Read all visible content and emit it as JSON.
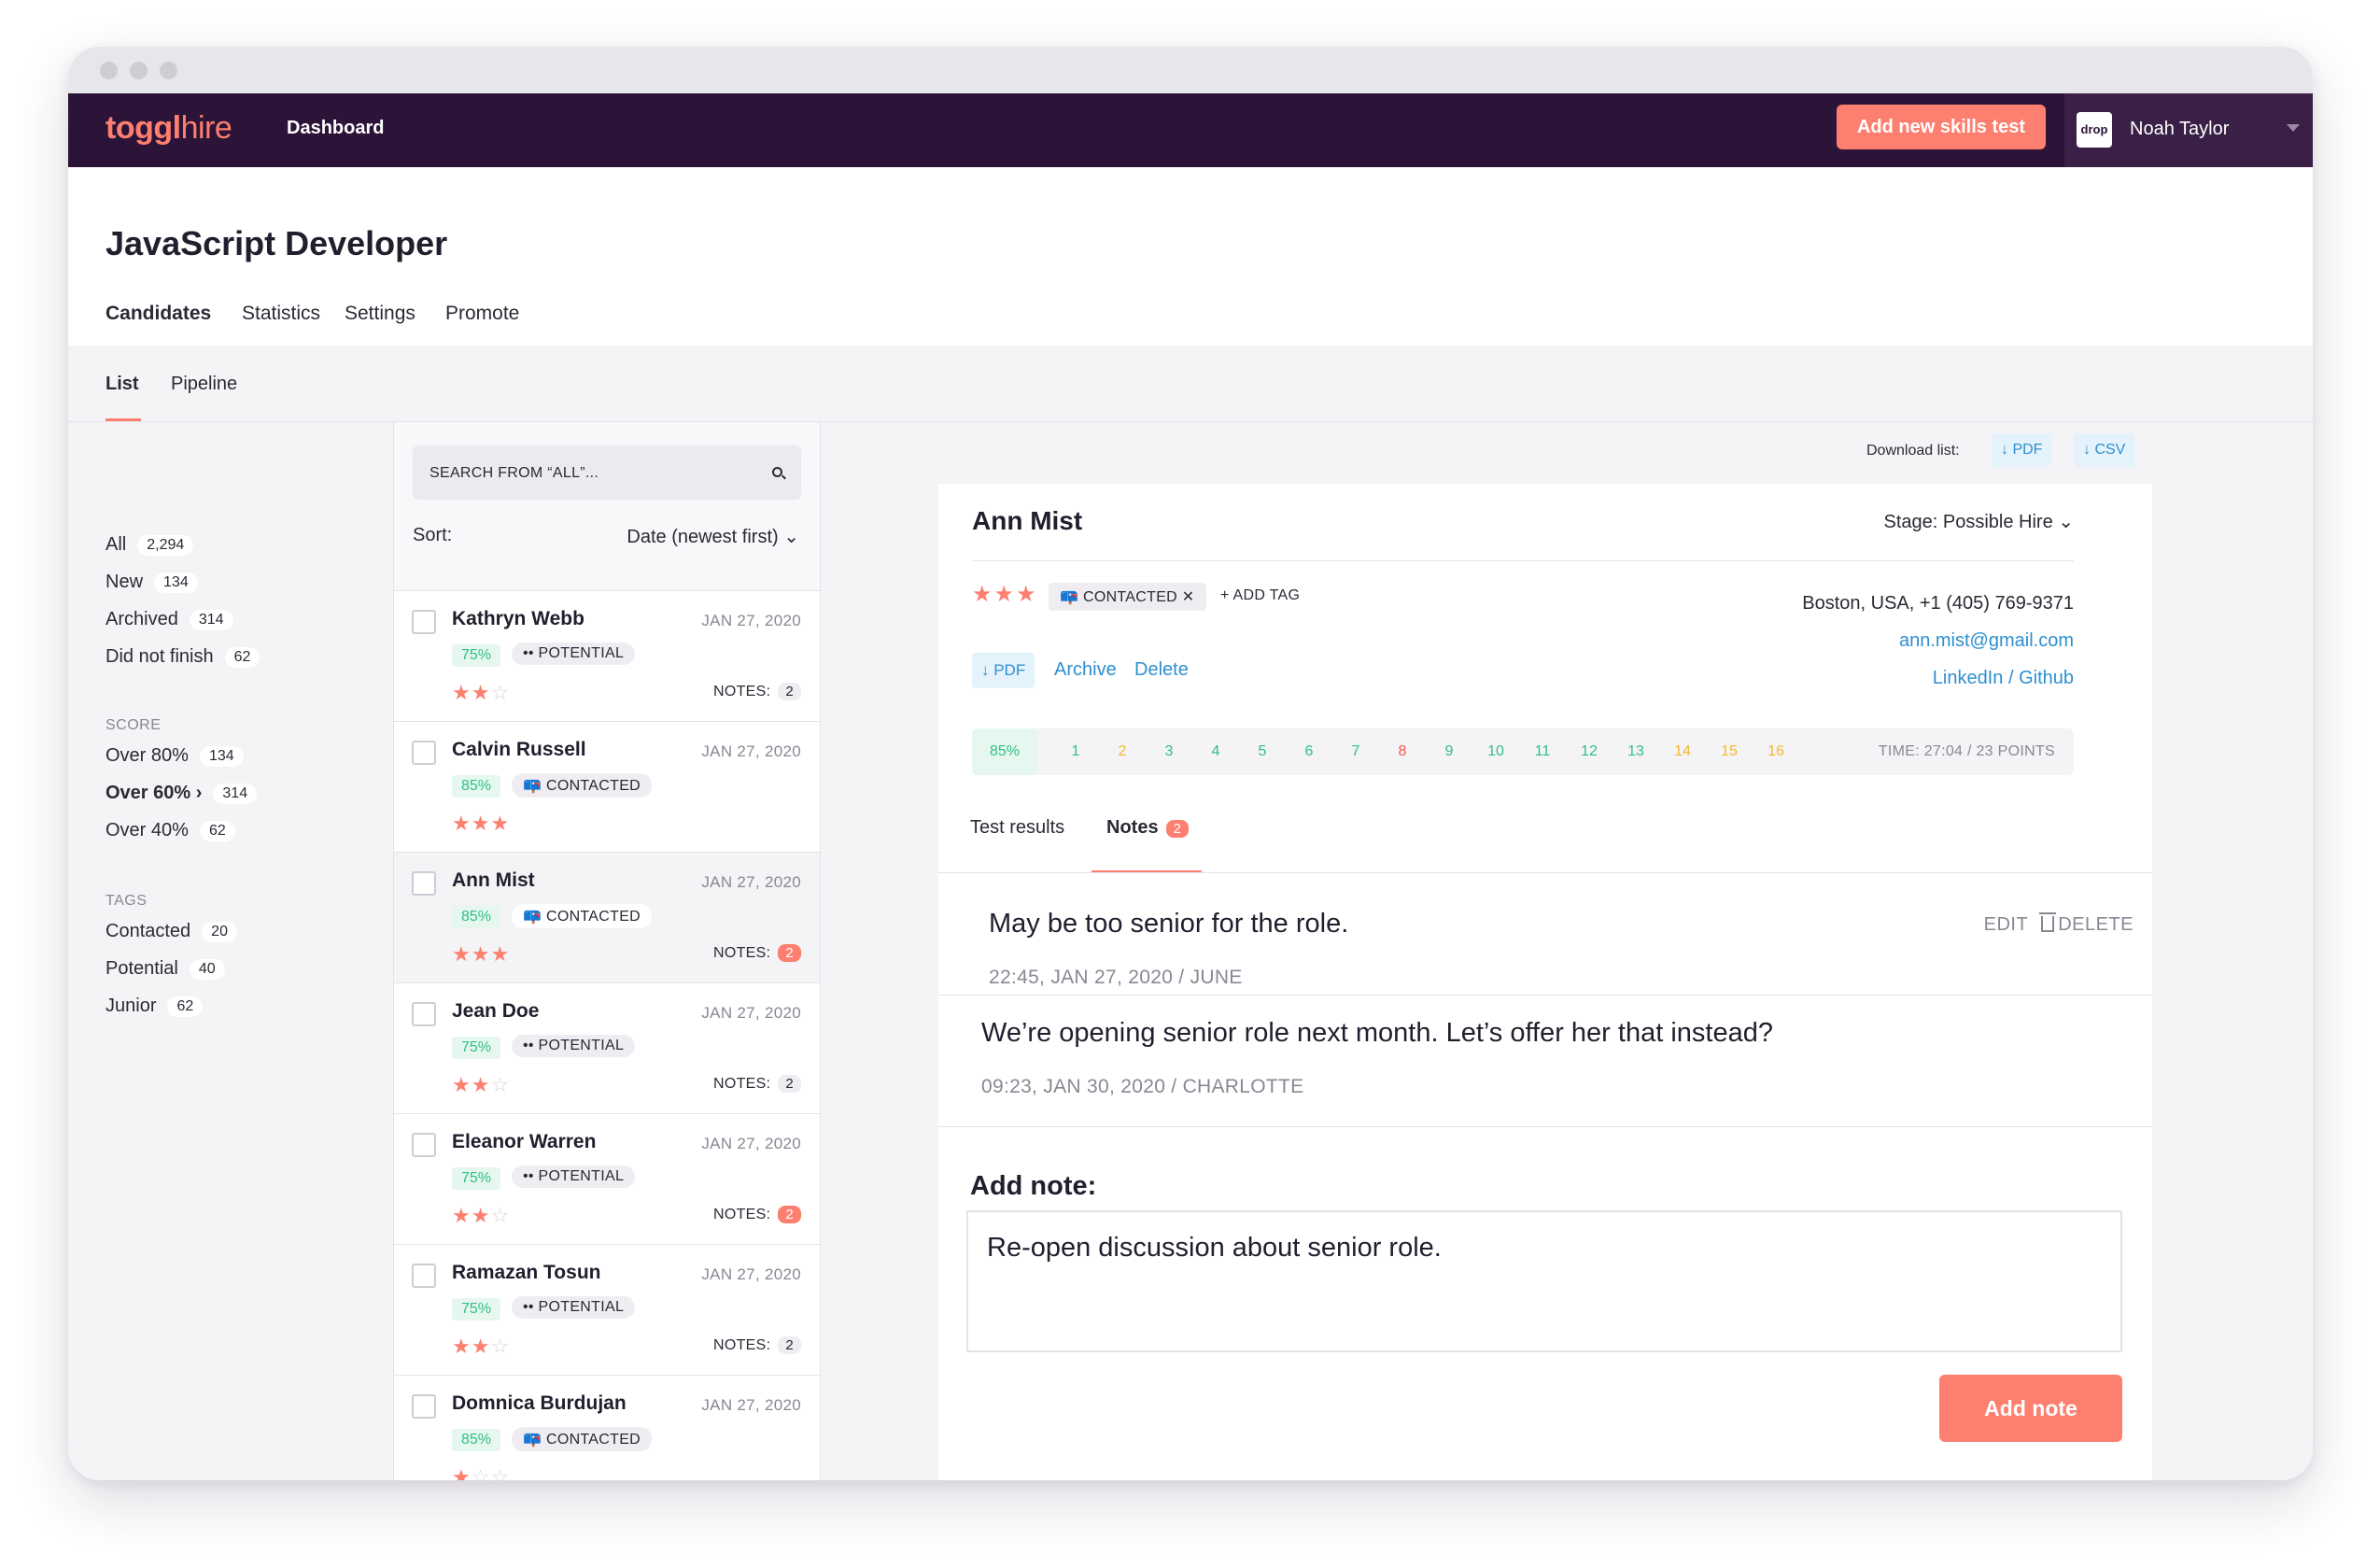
{
  "colors": {
    "brand": "#fd7f6f",
    "topbar": "#2c1338",
    "link": "#2e8fd0",
    "score_green": "#2fbf87"
  },
  "topbar": {
    "logo_bold": "toggl",
    "logo_light": "hire",
    "dashboard": "Dashboard",
    "add_test": "Add new skills test",
    "avatar_text": "drop",
    "username": "Noah Taylor"
  },
  "page": {
    "title": "JavaScript Developer"
  },
  "tabs": [
    {
      "label": "Candidates"
    },
    {
      "label": "Statistics"
    },
    {
      "label": "Settings"
    },
    {
      "label": "Promote"
    }
  ],
  "subtabs": [
    {
      "label": "List"
    },
    {
      "label": "Pipeline"
    }
  ],
  "filters": {
    "status": [
      {
        "label": "All",
        "count": "2,294"
      },
      {
        "label": "New",
        "count": "134"
      },
      {
        "label": "Archived",
        "count": "314"
      },
      {
        "label": "Did not finish",
        "count": "62"
      }
    ],
    "score_heading": "SCORE",
    "score": [
      {
        "label": "Over 80%",
        "count": "134"
      },
      {
        "label": "Over 60% ›",
        "count": "314"
      },
      {
        "label": "Over 40%",
        "count": "62"
      }
    ],
    "tags_heading": "TAGS",
    "tags": [
      {
        "label": "Contacted",
        "count": "20"
      },
      {
        "label": "Potential",
        "count": "40"
      },
      {
        "label": "Junior",
        "count": "62"
      }
    ]
  },
  "search": {
    "placeholder": "SEARCH FROM “ALL”..."
  },
  "sort": {
    "label": "Sort:",
    "value": "Date (newest first)"
  },
  "candidates": [
    {
      "name": "Kathryn Webb",
      "date": "JAN 27, 2020",
      "score": "75%",
      "tag": "•• POTENTIAL",
      "stars": 2,
      "notes_label": "NOTES:",
      "notes": "2",
      "notes_hot": false
    },
    {
      "name": "Calvin Russell",
      "date": "JAN 27, 2020",
      "score": "85%",
      "tag": "📪 CONTACTED",
      "stars": 3,
      "notes_label": "",
      "notes": "",
      "notes_hot": false
    },
    {
      "name": "Ann  Mist",
      "date": "JAN 27, 2020",
      "score": "85%",
      "tag": "📪 CONTACTED",
      "stars": 3,
      "notes_label": "NOTES:",
      "notes": "2",
      "notes_hot": true
    },
    {
      "name": "Jean Doe",
      "date": "JAN 27, 2020",
      "score": "75%",
      "tag": "•• POTENTIAL",
      "stars": 2,
      "notes_label": "NOTES:",
      "notes": "2",
      "notes_hot": false
    },
    {
      "name": "Eleanor Warren",
      "date": "JAN 27, 2020",
      "score": "75%",
      "tag": "•• POTENTIAL",
      "stars": 2,
      "notes_label": "NOTES:",
      "notes": "2",
      "notes_hot": true
    },
    {
      "name": "Ramazan Tosun",
      "date": "JAN 27, 2020",
      "score": "75%",
      "tag": "•• POTENTIAL",
      "stars": 2,
      "notes_label": "NOTES:",
      "notes": "2",
      "notes_hot": false
    },
    {
      "name": "Domnica Burdujan",
      "date": "JAN 27, 2020",
      "score": "85%",
      "tag": "📪 CONTACTED",
      "stars": 1,
      "notes_label": "",
      "notes": "",
      "notes_hot": false
    }
  ],
  "download": {
    "label": "Download list:",
    "pdf": "↓ PDF",
    "csv": "↓ CSV"
  },
  "detail": {
    "name": "Ann Mist",
    "stage": "Stage: Possible Hire ⌄",
    "stars": "★★★",
    "tag": "📪 CONTACTED  ✕",
    "add_tag": "+ ADD TAG",
    "location": "Boston, USA, +1 (405) 769-9371",
    "email": "ann.mist@gmail.com",
    "linkedin": "LinkedIn",
    "sep": "/",
    "github": "Github",
    "pdf": "↓ PDF",
    "archive": "Archive",
    "delete": "Delete",
    "score": "85%",
    "questions": [
      {
        "n": "1",
        "color": "#2fbf87"
      },
      {
        "n": "2",
        "color": "#f5b82e"
      },
      {
        "n": "3",
        "color": "#2fbf87"
      },
      {
        "n": "4",
        "color": "#2fbf87"
      },
      {
        "n": "5",
        "color": "#2fbf87"
      },
      {
        "n": "6",
        "color": "#2fbf87"
      },
      {
        "n": "7",
        "color": "#2fbf87"
      },
      {
        "n": "8",
        "color": "#f2574c"
      },
      {
        "n": "9",
        "color": "#2fbf87"
      },
      {
        "n": "10",
        "color": "#2fbf87"
      },
      {
        "n": "11",
        "color": "#2fbf87"
      },
      {
        "n": "12",
        "color": "#2fbf87"
      },
      {
        "n": "13",
        "color": "#2fbf87"
      },
      {
        "n": "14",
        "color": "#f5b82e"
      },
      {
        "n": "15",
        "color": "#f5b82e"
      },
      {
        "n": "16",
        "color": "#f5b82e"
      }
    ],
    "time": "TIME: 27:04  /  23 POINTS",
    "tab_results": "Test results",
    "tab_notes": "Notes",
    "notes_count": "2"
  },
  "notes": [
    {
      "text": "May be too senior for the role.",
      "meta": "22:45, JAN 27, 2020  /  JUNE",
      "edit": "EDIT",
      "delete": "DELETE"
    },
    {
      "text": "We’re opening senior role next month. Let’s offer her that instead?",
      "meta": "09:23, JAN 30, 2020  /  CHARLOTTE"
    }
  ],
  "add_note": {
    "label": "Add note:",
    "value": "Re-open discussion about senior role.",
    "button": "Add note"
  }
}
